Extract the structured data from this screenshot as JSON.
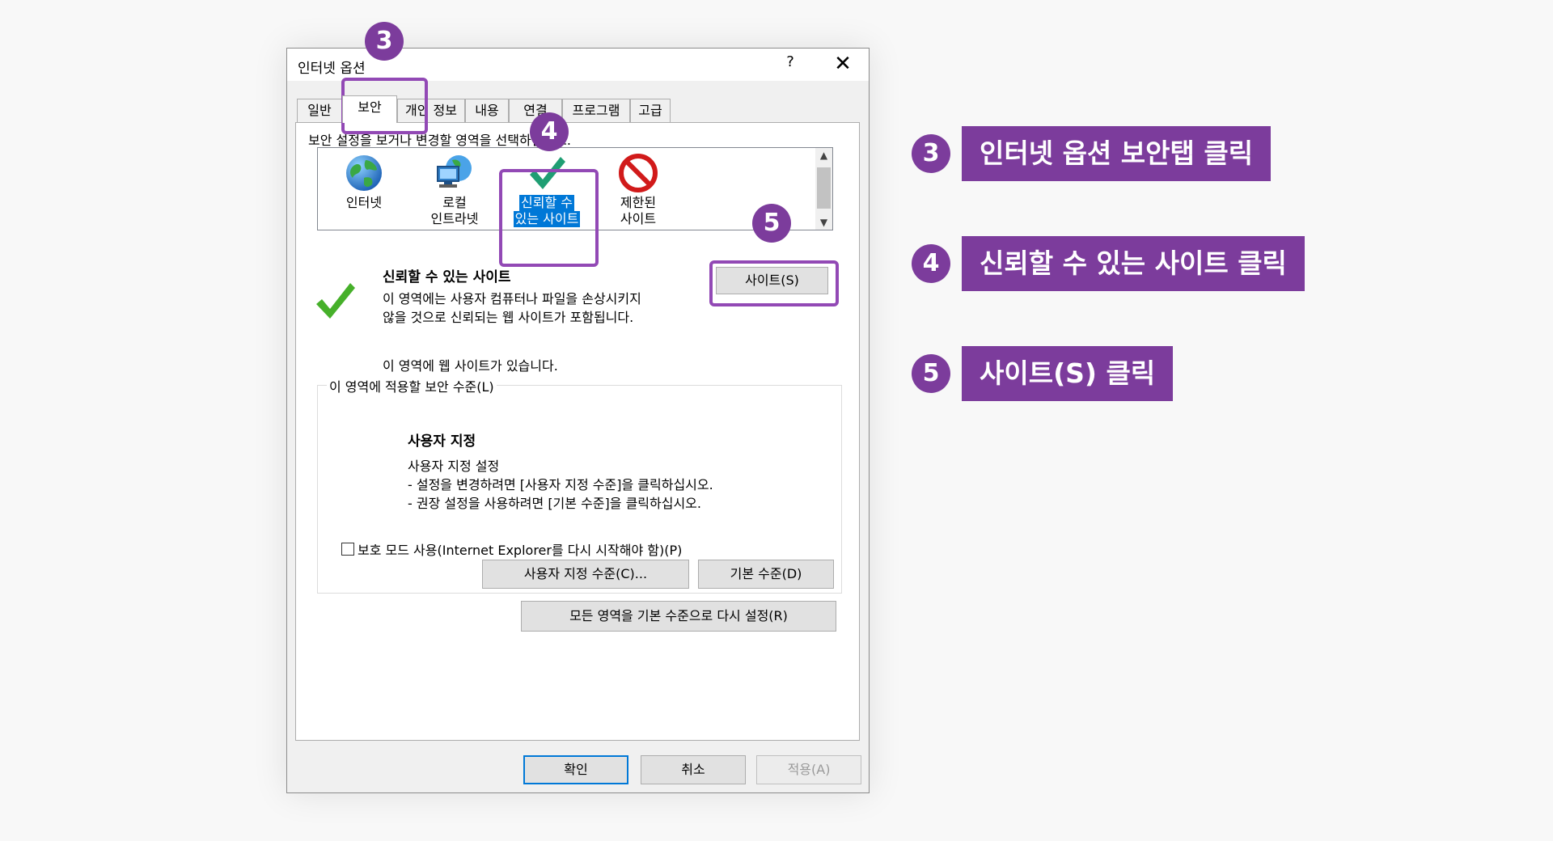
{
  "window": {
    "title": "인터넷 옵션",
    "help": "?",
    "close": "✕"
  },
  "tabs": [
    {
      "label": "일반"
    },
    {
      "label": "보안",
      "active": true
    },
    {
      "label": "개인 정보"
    },
    {
      "label": "내용"
    },
    {
      "label": "연결"
    },
    {
      "label": "프로그램"
    },
    {
      "label": "고급"
    }
  ],
  "security": {
    "zone_prompt": "보안 설정을 보거나 변경할 영역을 선택하십시오.",
    "zones": [
      {
        "label_line1": "인터넷",
        "label_line2": "",
        "icon": "globe-icon"
      },
      {
        "label_line1": "로컬",
        "label_line2": "인트라넷",
        "icon": "local-intranet-icon"
      },
      {
        "label_line1": "신뢰할 수",
        "label_line2": "있는 사이트",
        "icon": "trusted-check-icon",
        "selected": true
      },
      {
        "label_line1": "제한된",
        "label_line2": "사이트",
        "icon": "restricted-icon"
      }
    ],
    "zone_name": "신뢰할 수 있는 사이트",
    "zone_desc_line1": "이 영역에는 사용자 컴퓨터나 파일을 손상시키지",
    "zone_desc_line2": "않을 것으로 신뢰되는 웹 사이트가 포함됩니다.",
    "no_sites": "이 영역에 웹 사이트가 있습니다.",
    "sites_button": "사이트(S)",
    "level_group_title": "이 영역에 적용할 보안 수준(L)",
    "level_title": "사용자 지정",
    "level_desc_line1": "사용자 지정 설정",
    "level_desc_line2": "- 설정을 변경하려면 [사용자 지정 수준]을 클릭하십시오.",
    "level_desc_line3": "- 권장 설정을 사용하려면 [기본 수준]을 클릭하십시오.",
    "protected_mode_label": "보호 모드 사용(Internet Explorer를 다시 시작해야 함)(P)",
    "protected_mode_checked": false,
    "custom_level_button": "사용자 지정 수준(C)...",
    "default_level_button": "기본 수준(D)",
    "reset_all_button": "모든 영역을 기본 수준으로 다시 설정(R)"
  },
  "footer": {
    "ok": "확인",
    "cancel": "취소",
    "apply": "적용(A)"
  },
  "steps": [
    {
      "number": "3",
      "label": "인터넷 옵션 보안탭 클릭"
    },
    {
      "number": "4",
      "label": "신뢰할 수 있는 사이트 클릭"
    },
    {
      "number": "5",
      "label": "사이트(S) 클릭"
    }
  ],
  "colors": {
    "accent": "#7c3c9c",
    "highlight": "#9249b5",
    "selection": "#0078d7"
  }
}
